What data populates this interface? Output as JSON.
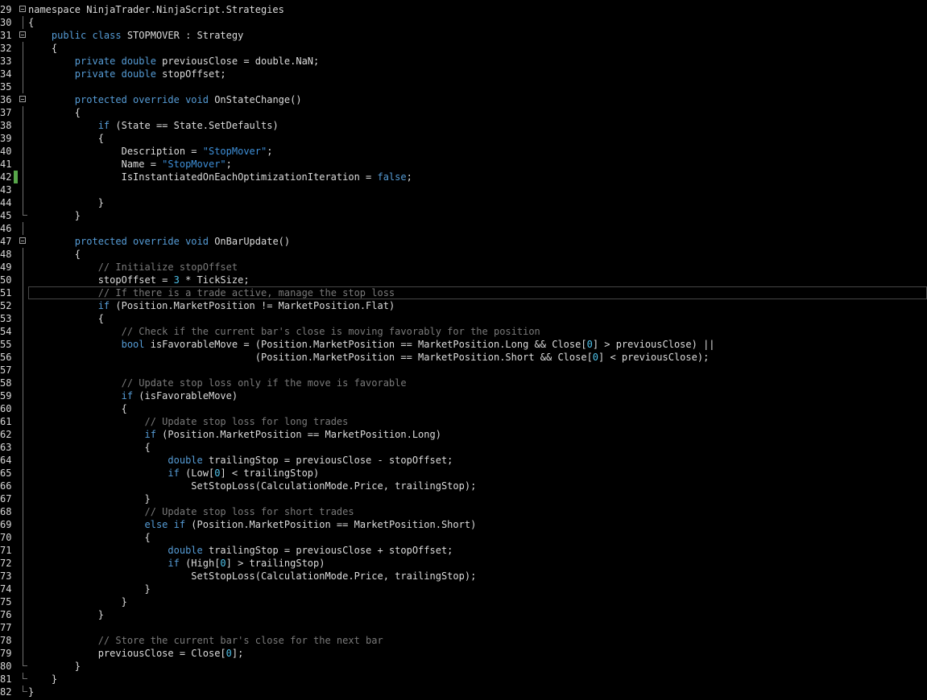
{
  "colors": {
    "background": "#000000",
    "keyword": "#569cd6",
    "comment": "#7a7a7a",
    "string": "#3e8fd8",
    "number": "#4fc1e9",
    "text": "#dcdcdc",
    "change_marker": "#57a64a"
  },
  "editor": {
    "lines": [
      {
        "n": "29",
        "fold": true,
        "change": false,
        "current": false,
        "tokens": [
          [
            "t",
            "namespace NinjaTrader.NinjaScript.Strategies"
          ]
        ]
      },
      {
        "n": "30",
        "fold": false,
        "change": false,
        "current": false,
        "tokens": [
          [
            "t",
            "{"
          ]
        ]
      },
      {
        "n": "31",
        "fold": true,
        "change": false,
        "current": false,
        "tokens": [
          [
            "t",
            "    "
          ],
          [
            "k",
            "public class"
          ],
          [
            "t",
            " STOPMOVER : Strategy"
          ]
        ]
      },
      {
        "n": "32",
        "fold": false,
        "change": false,
        "current": false,
        "tokens": [
          [
            "t",
            "    {"
          ]
        ]
      },
      {
        "n": "33",
        "fold": false,
        "change": false,
        "current": false,
        "tokens": [
          [
            "t",
            "        "
          ],
          [
            "k",
            "private double"
          ],
          [
            "t",
            " previousClose = double.NaN;"
          ]
        ]
      },
      {
        "n": "34",
        "fold": false,
        "change": false,
        "current": false,
        "tokens": [
          [
            "t",
            "        "
          ],
          [
            "k",
            "private double"
          ],
          [
            "t",
            " stopOffset;"
          ]
        ]
      },
      {
        "n": "35",
        "fold": false,
        "change": false,
        "current": false,
        "tokens": []
      },
      {
        "n": "36",
        "fold": true,
        "change": false,
        "current": false,
        "tokens": [
          [
            "t",
            "        "
          ],
          [
            "k",
            "protected override void"
          ],
          [
            "t",
            " OnStateChange()"
          ]
        ]
      },
      {
        "n": "37",
        "fold": false,
        "change": false,
        "current": false,
        "tokens": [
          [
            "t",
            "        {"
          ]
        ]
      },
      {
        "n": "38",
        "fold": false,
        "change": false,
        "current": false,
        "tokens": [
          [
            "t",
            "            "
          ],
          [
            "k",
            "if"
          ],
          [
            "t",
            " (State == State.SetDefaults)"
          ]
        ]
      },
      {
        "n": "39",
        "fold": false,
        "change": false,
        "current": false,
        "tokens": [
          [
            "t",
            "            {"
          ]
        ]
      },
      {
        "n": "40",
        "fold": false,
        "change": false,
        "current": false,
        "tokens": [
          [
            "t",
            "                Description = "
          ],
          [
            "s",
            "\"StopMover\""
          ],
          [
            "t",
            ";"
          ]
        ]
      },
      {
        "n": "41",
        "fold": false,
        "change": false,
        "current": false,
        "tokens": [
          [
            "t",
            "                Name = "
          ],
          [
            "s",
            "\"StopMover\""
          ],
          [
            "t",
            ";"
          ]
        ]
      },
      {
        "n": "42",
        "fold": false,
        "change": true,
        "current": false,
        "tokens": [
          [
            "t",
            "                IsInstantiatedOnEachOptimizationIteration = "
          ],
          [
            "k",
            "false"
          ],
          [
            "t",
            ";"
          ]
        ]
      },
      {
        "n": "43",
        "fold": false,
        "change": false,
        "current": false,
        "tokens": []
      },
      {
        "n": "44",
        "fold": false,
        "change": false,
        "current": false,
        "tokens": [
          [
            "t",
            "            }"
          ]
        ]
      },
      {
        "n": "45",
        "fold": false,
        "change": false,
        "current": false,
        "end": true,
        "tokens": [
          [
            "t",
            "        }"
          ]
        ]
      },
      {
        "n": "46",
        "fold": false,
        "change": false,
        "current": false,
        "tokens": []
      },
      {
        "n": "47",
        "fold": true,
        "change": false,
        "current": false,
        "tokens": [
          [
            "t",
            "        "
          ],
          [
            "k",
            "protected override void"
          ],
          [
            "t",
            " OnBarUpdate()"
          ]
        ]
      },
      {
        "n": "48",
        "fold": false,
        "change": false,
        "current": false,
        "tokens": [
          [
            "t",
            "        {"
          ]
        ]
      },
      {
        "n": "49",
        "fold": false,
        "change": false,
        "current": false,
        "tokens": [
          [
            "t",
            "            "
          ],
          [
            "c",
            "// Initialize stopOffset"
          ]
        ]
      },
      {
        "n": "50",
        "fold": false,
        "change": false,
        "current": false,
        "tokens": [
          [
            "t",
            "            stopOffset = "
          ],
          [
            "n",
            "3"
          ],
          [
            "t",
            " * TickSize;"
          ]
        ]
      },
      {
        "n": "51",
        "fold": false,
        "change": false,
        "current": true,
        "tokens": [
          [
            "t",
            "            "
          ],
          [
            "c",
            "// If there is a trade active, manage the stop loss"
          ]
        ]
      },
      {
        "n": "52",
        "fold": false,
        "change": false,
        "current": false,
        "tokens": [
          [
            "t",
            "            "
          ],
          [
            "k",
            "if"
          ],
          [
            "t",
            " (Position.MarketPosition != MarketPosition.Flat)"
          ]
        ]
      },
      {
        "n": "53",
        "fold": false,
        "change": false,
        "current": false,
        "tokens": [
          [
            "t",
            "            {"
          ]
        ]
      },
      {
        "n": "54",
        "fold": false,
        "change": false,
        "current": false,
        "tokens": [
          [
            "t",
            "                "
          ],
          [
            "c",
            "// Check if the current bar's close is moving favorably for the position"
          ]
        ]
      },
      {
        "n": "55",
        "fold": false,
        "change": false,
        "current": false,
        "tokens": [
          [
            "t",
            "                "
          ],
          [
            "k",
            "bool"
          ],
          [
            "t",
            " isFavorableMove = (Position.MarketPosition == MarketPosition.Long && Close["
          ],
          [
            "n",
            "0"
          ],
          [
            "t",
            "] > previousClose) ||"
          ]
        ]
      },
      {
        "n": "56",
        "fold": false,
        "change": false,
        "current": false,
        "tokens": [
          [
            "t",
            "                                       (Position.MarketPosition == MarketPosition.Short && Close["
          ],
          [
            "n",
            "0"
          ],
          [
            "t",
            "] < previousClose);"
          ]
        ]
      },
      {
        "n": "57",
        "fold": false,
        "change": false,
        "current": false,
        "tokens": []
      },
      {
        "n": "58",
        "fold": false,
        "change": false,
        "current": false,
        "tokens": [
          [
            "t",
            "                "
          ],
          [
            "c",
            "// Update stop loss only if the move is favorable"
          ]
        ]
      },
      {
        "n": "59",
        "fold": false,
        "change": false,
        "current": false,
        "tokens": [
          [
            "t",
            "                "
          ],
          [
            "k",
            "if"
          ],
          [
            "t",
            " (isFavorableMove)"
          ]
        ]
      },
      {
        "n": "60",
        "fold": false,
        "change": false,
        "current": false,
        "tokens": [
          [
            "t",
            "                {"
          ]
        ]
      },
      {
        "n": "61",
        "fold": false,
        "change": false,
        "current": false,
        "tokens": [
          [
            "t",
            "                    "
          ],
          [
            "c",
            "// Update stop loss for long trades"
          ]
        ]
      },
      {
        "n": "62",
        "fold": false,
        "change": false,
        "current": false,
        "tokens": [
          [
            "t",
            "                    "
          ],
          [
            "k",
            "if"
          ],
          [
            "t",
            " (Position.MarketPosition == MarketPosition.Long)"
          ]
        ]
      },
      {
        "n": "63",
        "fold": false,
        "change": false,
        "current": false,
        "tokens": [
          [
            "t",
            "                    {"
          ]
        ]
      },
      {
        "n": "64",
        "fold": false,
        "change": false,
        "current": false,
        "tokens": [
          [
            "t",
            "                        "
          ],
          [
            "k",
            "double"
          ],
          [
            "t",
            " trailingStop = previousClose - stopOffset;"
          ]
        ]
      },
      {
        "n": "65",
        "fold": false,
        "change": false,
        "current": false,
        "tokens": [
          [
            "t",
            "                        "
          ],
          [
            "k",
            "if"
          ],
          [
            "t",
            " (Low["
          ],
          [
            "n",
            "0"
          ],
          [
            "t",
            "] < trailingStop)"
          ]
        ]
      },
      {
        "n": "66",
        "fold": false,
        "change": false,
        "current": false,
        "tokens": [
          [
            "t",
            "                            SetStopLoss(CalculationMode.Price, trailingStop);"
          ]
        ]
      },
      {
        "n": "67",
        "fold": false,
        "change": false,
        "current": false,
        "tokens": [
          [
            "t",
            "                    }"
          ]
        ]
      },
      {
        "n": "68",
        "fold": false,
        "change": false,
        "current": false,
        "tokens": [
          [
            "t",
            "                    "
          ],
          [
            "c",
            "// Update stop loss for short trades"
          ]
        ]
      },
      {
        "n": "69",
        "fold": false,
        "change": false,
        "current": false,
        "tokens": [
          [
            "t",
            "                    "
          ],
          [
            "k",
            "else if"
          ],
          [
            "t",
            " (Position.MarketPosition == MarketPosition.Short)"
          ]
        ]
      },
      {
        "n": "70",
        "fold": false,
        "change": false,
        "current": false,
        "tokens": [
          [
            "t",
            "                    {"
          ]
        ]
      },
      {
        "n": "71",
        "fold": false,
        "change": false,
        "current": false,
        "tokens": [
          [
            "t",
            "                        "
          ],
          [
            "k",
            "double"
          ],
          [
            "t",
            " trailingStop = previousClose + stopOffset;"
          ]
        ]
      },
      {
        "n": "72",
        "fold": false,
        "change": false,
        "current": false,
        "tokens": [
          [
            "t",
            "                        "
          ],
          [
            "k",
            "if"
          ],
          [
            "t",
            " (High["
          ],
          [
            "n",
            "0"
          ],
          [
            "t",
            "] > trailingStop)"
          ]
        ]
      },
      {
        "n": "73",
        "fold": false,
        "change": false,
        "current": false,
        "tokens": [
          [
            "t",
            "                            SetStopLoss(CalculationMode.Price, trailingStop);"
          ]
        ]
      },
      {
        "n": "74",
        "fold": false,
        "change": false,
        "current": false,
        "tokens": [
          [
            "t",
            "                    }"
          ]
        ]
      },
      {
        "n": "75",
        "fold": false,
        "change": false,
        "current": false,
        "tokens": [
          [
            "t",
            "                }"
          ]
        ]
      },
      {
        "n": "76",
        "fold": false,
        "change": false,
        "current": false,
        "tokens": [
          [
            "t",
            "            }"
          ]
        ]
      },
      {
        "n": "77",
        "fold": false,
        "change": false,
        "current": false,
        "tokens": []
      },
      {
        "n": "78",
        "fold": false,
        "change": false,
        "current": false,
        "tokens": [
          [
            "t",
            "            "
          ],
          [
            "c",
            "// Store the current bar's close for the next bar"
          ]
        ]
      },
      {
        "n": "79",
        "fold": false,
        "change": false,
        "current": false,
        "tokens": [
          [
            "t",
            "            previousClose = Close["
          ],
          [
            "n",
            "0"
          ],
          [
            "t",
            "];"
          ]
        ]
      },
      {
        "n": "80",
        "fold": false,
        "change": false,
        "current": false,
        "end": true,
        "tokens": [
          [
            "t",
            "        }"
          ]
        ]
      },
      {
        "n": "81",
        "fold": false,
        "change": false,
        "current": false,
        "end": true,
        "tokens": [
          [
            "t",
            "    }"
          ]
        ]
      },
      {
        "n": "82",
        "fold": false,
        "change": false,
        "current": false,
        "end": true,
        "tokens": [
          [
            "t",
            "}"
          ]
        ]
      }
    ]
  }
}
